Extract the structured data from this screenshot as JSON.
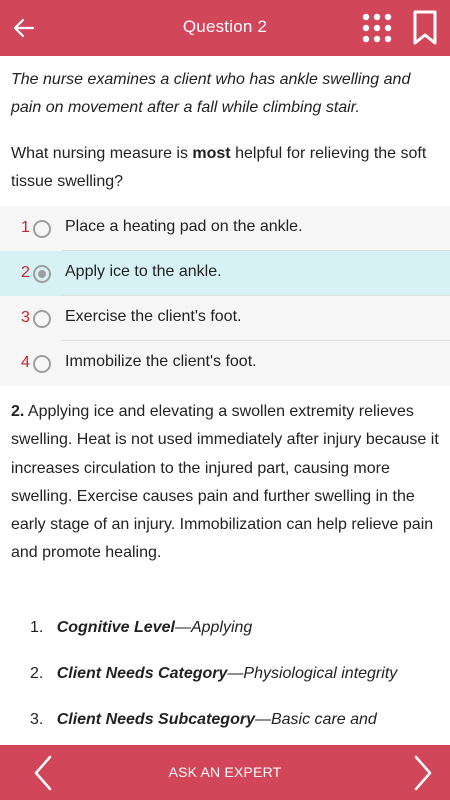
{
  "header": {
    "title": "Question 2",
    "back_icon": "arrow-left-icon",
    "grid_icon": "grid-icon",
    "bookmark_icon": "bookmark-icon",
    "bar_color": "#d2465a"
  },
  "question": {
    "scenario": "The nurse examines a client who has ankle swelling and pain on movement after a fall while climbing stair.",
    "stem_before": "What nursing measure is ",
    "stem_bold": "most",
    "stem_after": " helpful for relieving the soft tissue swelling?"
  },
  "options": [
    {
      "number": "1",
      "text": "Place a heating pad on the ankle.",
      "selected": false
    },
    {
      "number": "2",
      "text": "Apply ice to the ankle.",
      "selected": true
    },
    {
      "number": "3",
      "text": "Exercise the client's foot.",
      "selected": false
    },
    {
      "number": "4",
      "text": "Immobilize the client's foot.",
      "selected": false
    }
  ],
  "rationale": {
    "answer_label": "2.",
    "text": " Applying ice and elevating a swollen extremity relieves swelling. Heat is not used immediately after injury because it increases circulation to the injured part, causing more swelling. Exercise causes pain and further swelling in the early stage of an injury. Immobilization can help relieve pain and promote healing."
  },
  "levels": [
    {
      "index": "1.",
      "label": "Cognitive Level",
      "value": "—Applying"
    },
    {
      "index": "2.",
      "label": "Client Needs Category",
      "value": "—Physiological integrity"
    },
    {
      "index": "3.",
      "label": "Client Needs Subcategory",
      "value": "—Basic care and"
    }
  ],
  "footer": {
    "ask_label": "ASK AN EXPERT",
    "prev_icon": "chevron-left-icon",
    "next_icon": "chevron-right-icon"
  },
  "colors": {
    "accent": "#d2465a",
    "selected_row": "#d7f2f5",
    "option_row": "#f6f6f6",
    "option_number": "#c0272d"
  }
}
